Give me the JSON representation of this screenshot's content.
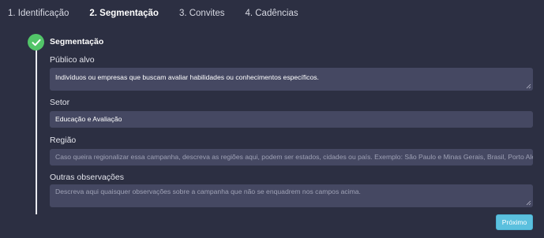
{
  "tabs": [
    {
      "label": "1. Identificação",
      "active": false
    },
    {
      "label": "2. Segmentação",
      "active": true
    },
    {
      "label": "3. Convites",
      "active": false
    },
    {
      "label": "4. Cadências",
      "active": false
    }
  ],
  "section": {
    "title": "Segmentação"
  },
  "fields": {
    "publico_alvo": {
      "label": "Público alvo",
      "value": "Indivíduos ou empresas que buscam avaliar habilidades ou conhecimentos específicos."
    },
    "setor": {
      "label": "Setor",
      "value": "Educação e Avaliação"
    },
    "regiao": {
      "label": "Região",
      "placeholder": "Caso queira regionalizar essa campanha, descreva as regiões aqui, podem ser estados, cidades ou país. Exemplo: São Paulo e Minas Gerais, Brasil, Porto Ale"
    },
    "outras_observacoes": {
      "label": "Outras observações",
      "placeholder": "Descreva aqui quaisquer observações sobre a campanha que não se enquadrem nos campos acima."
    }
  },
  "buttons": {
    "next": "Próximo"
  },
  "colors": {
    "background": "#2c2f42",
    "field": "#454862",
    "success": "#52c569",
    "button": "#5bc0de"
  }
}
